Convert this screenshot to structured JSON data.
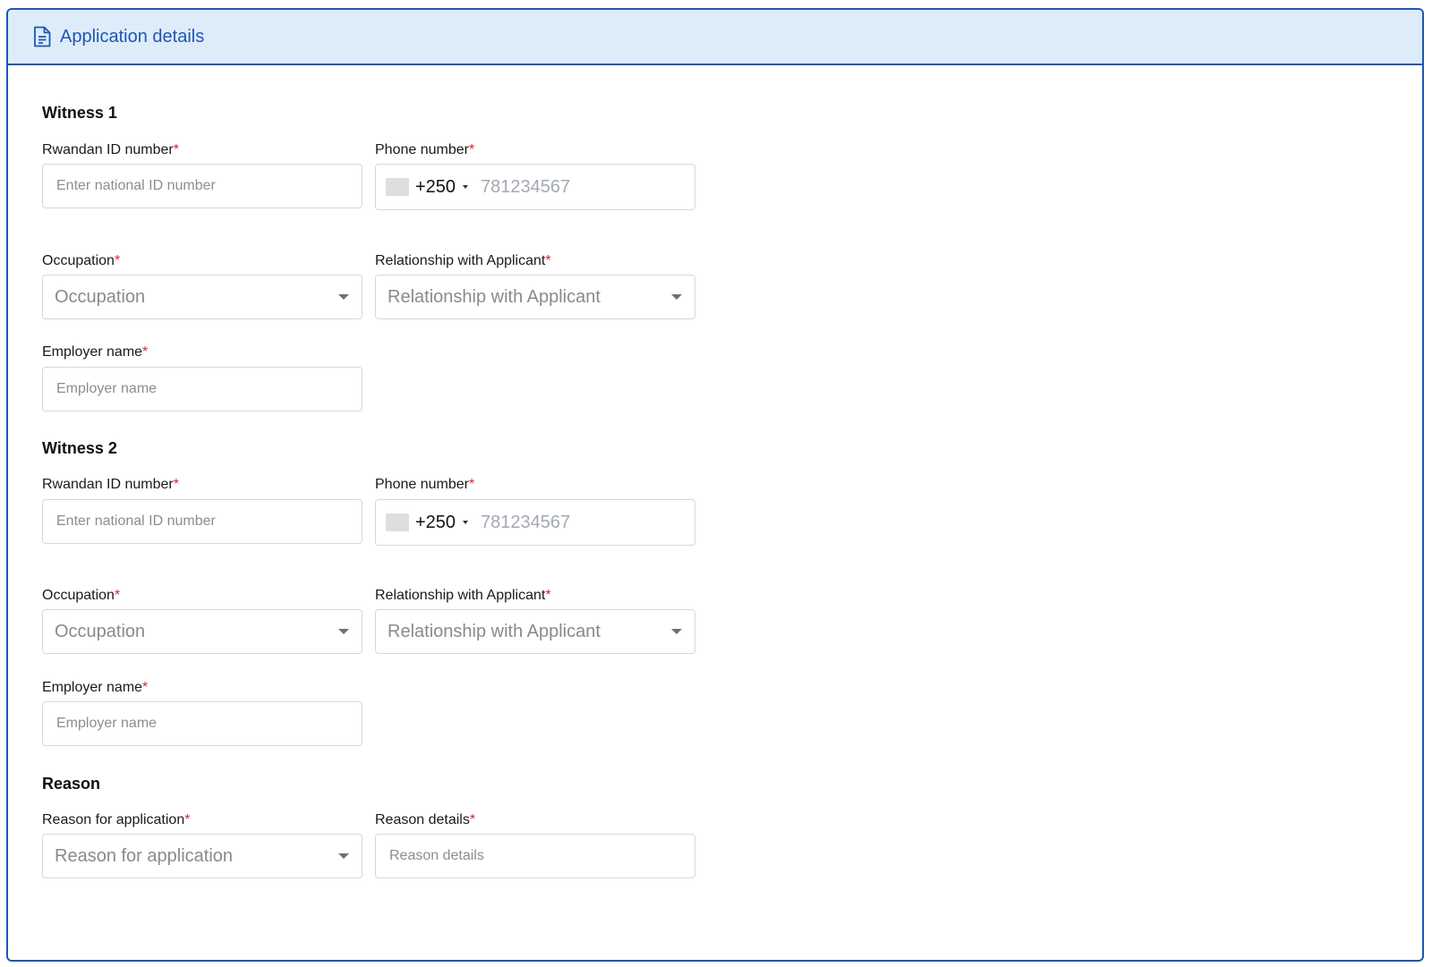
{
  "panel": {
    "title": "Application details",
    "icon": "document-icon"
  },
  "witness1": {
    "title": "Witness 1",
    "id_label": "Rwandan ID number",
    "id_placeholder": "Enter national ID number",
    "phone_label": "Phone number",
    "phone_code": "+250",
    "phone_placeholder": "781234567",
    "occupation_label": "Occupation",
    "occupation_value": "Occupation",
    "relationship_label": "Relationship with Applicant",
    "relationship_value": "Relationship with Applicant",
    "employer_label": "Employer name",
    "employer_placeholder": "Employer name"
  },
  "witness2": {
    "title": "Witness 2",
    "id_label": "Rwandan ID number",
    "id_placeholder": "Enter national ID number",
    "phone_label": "Phone number",
    "phone_code": "+250",
    "phone_placeholder": "781234567",
    "occupation_label": "Occupation",
    "occupation_value": "Occupation",
    "relationship_label": "Relationship with Applicant",
    "relationship_value": "Relationship with Applicant",
    "employer_label": "Employer name",
    "employer_placeholder": "Employer name"
  },
  "reason": {
    "title": "Reason",
    "reason_label": "Reason for application",
    "reason_value": "Reason for application",
    "details_label": "Reason details",
    "details_placeholder": "Reason details"
  },
  "required_marker": "*",
  "colors": {
    "accent": "#1f56b5",
    "header_bg": "#deecf9",
    "required": "#e0242c",
    "border": "#d4d8dd"
  }
}
